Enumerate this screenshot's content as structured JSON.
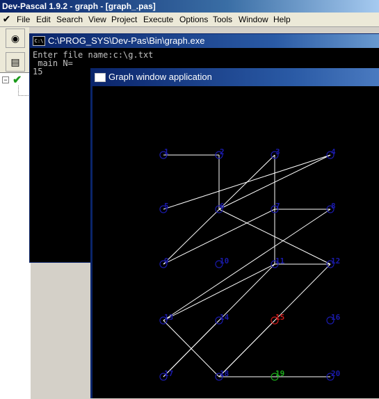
{
  "ide": {
    "title": "Dev-Pascal 1.9.2 - graph - [graph_.pas]",
    "menu": [
      "File",
      "Edit",
      "Search",
      "View",
      "Project",
      "Execute",
      "Options",
      "Tools",
      "Window",
      "Help"
    ],
    "toolbar_icons": [
      "compile-icon",
      "save-icon"
    ],
    "tree_icons": [
      "expand-icon",
      "checkmark-icon"
    ]
  },
  "console": {
    "title": "C:\\PROG_SYS\\Dev-Pas\\Bin\\graph.exe",
    "icon_text": "C:\\",
    "lines": [
      "Enter file name:c:\\g.txt",
      " main N=",
      "15"
    ]
  },
  "graph_window": {
    "title": "Graph window application",
    "colors": {
      "background": "#000000",
      "edge": "#ffffff",
      "node_default": "#1a1aaa",
      "node_start": "#cc1a1a",
      "node_target": "#1aaa1a"
    },
    "nodes": [
      {
        "id": 1,
        "label": "1",
        "color": "node_default"
      },
      {
        "id": 2,
        "label": "2",
        "color": "node_default"
      },
      {
        "id": 3,
        "label": "3",
        "color": "node_default"
      },
      {
        "id": 4,
        "label": "4",
        "color": "node_default"
      },
      {
        "id": 5,
        "label": "5",
        "color": "node_default"
      },
      {
        "id": 6,
        "label": "6",
        "color": "node_default"
      },
      {
        "id": 7,
        "label": "7",
        "color": "node_default"
      },
      {
        "id": 8,
        "label": "8",
        "color": "node_default"
      },
      {
        "id": 9,
        "label": "9",
        "color": "node_default"
      },
      {
        "id": 10,
        "label": "10",
        "color": "node_default"
      },
      {
        "id": 11,
        "label": "11",
        "color": "node_default"
      },
      {
        "id": 12,
        "label": "12",
        "color": "node_default"
      },
      {
        "id": 13,
        "label": "13",
        "color": "node_default"
      },
      {
        "id": 14,
        "label": "14",
        "color": "node_default"
      },
      {
        "id": 15,
        "label": "15",
        "color": "node_start"
      },
      {
        "id": 16,
        "label": "16",
        "color": "node_default"
      },
      {
        "id": 17,
        "label": "17",
        "color": "node_default"
      },
      {
        "id": 18,
        "label": "18",
        "color": "node_default"
      },
      {
        "id": 19,
        "label": "19",
        "color": "node_target"
      },
      {
        "id": 20,
        "label": "20",
        "color": "node_default"
      }
    ],
    "edges": [
      [
        1,
        2
      ],
      [
        2,
        6
      ],
      [
        6,
        4
      ],
      [
        6,
        12
      ],
      [
        4,
        5
      ],
      [
        3,
        7
      ],
      [
        3,
        9
      ],
      [
        7,
        9
      ],
      [
        7,
        8
      ],
      [
        7,
        11
      ],
      [
        8,
        13
      ],
      [
        11,
        13
      ],
      [
        11,
        12
      ],
      [
        11,
        17
      ],
      [
        14,
        17
      ],
      [
        13,
        18
      ],
      [
        18,
        15
      ],
      [
        12,
        18
      ],
      [
        18,
        19
      ],
      [
        19,
        20
      ]
    ]
  }
}
